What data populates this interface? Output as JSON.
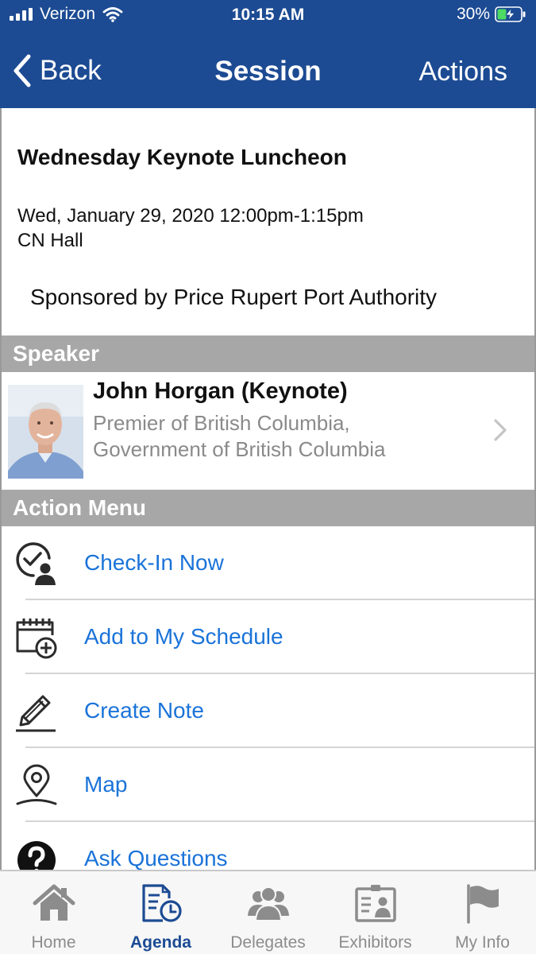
{
  "status_bar": {
    "carrier": "Verizon",
    "time": "10:15 AM",
    "battery": "30%"
  },
  "nav": {
    "back_label": "Back",
    "title": "Session",
    "actions_label": "Actions"
  },
  "session": {
    "title": "Wednesday Keynote Luncheon",
    "datetime": "Wed, January 29, 2020 12:00pm-1:15pm",
    "room": "CN Hall",
    "sponsor": "Sponsored by Price Rupert Port Authority"
  },
  "speaker_section": {
    "header": "Speaker",
    "name": "John Horgan (Keynote)",
    "title_line1": "Premier of British Columbia,",
    "title_line2": "Government of British Columbia"
  },
  "action_menu": {
    "header": "Action Menu",
    "items": [
      {
        "label": "Check-In Now",
        "icon": "check-in-icon"
      },
      {
        "label": "Add to My Schedule",
        "icon": "calendar-add-icon"
      },
      {
        "label": "Create Note",
        "icon": "pencil-icon"
      },
      {
        "label": "Map",
        "icon": "map-pin-icon"
      },
      {
        "label": "Ask Questions",
        "icon": "question-icon"
      }
    ]
  },
  "tabs": [
    {
      "label": "Home",
      "icon": "home-icon",
      "active": false
    },
    {
      "label": "Agenda",
      "icon": "agenda-icon",
      "active": true
    },
    {
      "label": "Delegates",
      "icon": "delegates-icon",
      "active": false
    },
    {
      "label": "Exhibitors",
      "icon": "exhibitors-icon",
      "active": false
    },
    {
      "label": "My Info",
      "icon": "flag-icon",
      "active": false
    }
  ],
  "colors": {
    "brand": "#1c4b93",
    "link": "#1a73d9",
    "section_header": "#a7a7a7",
    "battery_charge": "#4cd964"
  }
}
